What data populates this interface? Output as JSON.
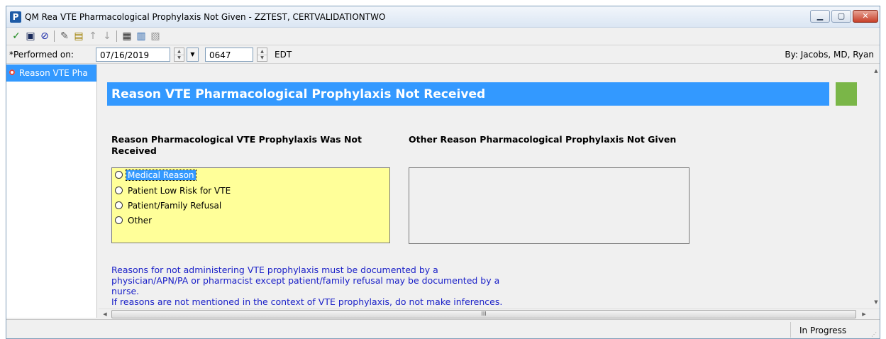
{
  "window": {
    "app_icon_letter": "P",
    "title": "QM Rea VTE Pharmacological Prophylaxis Not Given - ZZTEST, CERTVALIDATIONTWO",
    "min_glyph": "▁",
    "max_glyph": "▢",
    "close_glyph": "✕"
  },
  "toolbar": {
    "buttons": [
      {
        "icon": "checkmark-icon",
        "glyph": "✓",
        "color": "#1f8a1f"
      },
      {
        "icon": "save-icon",
        "glyph": "▣",
        "color": "#1a2a5a"
      },
      {
        "icon": "cancel-icon",
        "glyph": "⊘",
        "color": "#1a2aa8"
      },
      {
        "icon": "pen-icon",
        "glyph": "✎",
        "color": "#5a5a5a"
      },
      {
        "icon": "form-icon",
        "glyph": "▤",
        "color": "#a08000"
      },
      {
        "icon": "arrow-up-icon",
        "glyph": "↑",
        "color": "#a0a0a0"
      },
      {
        "icon": "arrow-down-icon",
        "glyph": "↓",
        "color": "#a0a0a0"
      },
      {
        "icon": "calculator-icon",
        "glyph": "▦",
        "color": "#2a2a2a"
      },
      {
        "icon": "calendar-icon",
        "glyph": "▥",
        "color": "#1a5aa8"
      },
      {
        "icon": "document-icon",
        "glyph": "▧",
        "color": "#909090"
      }
    ]
  },
  "performed": {
    "label": "*Performed on:",
    "date": "07/16/2019",
    "time": "0647",
    "timezone": "EDT",
    "by": "By:  Jacobs, MD, Ryan"
  },
  "nav": {
    "items": [
      {
        "label": "Reason VTE Pha",
        "selected": true
      }
    ]
  },
  "form": {
    "header_title": "Reason VTE Pharmacological Prophylaxis Not Received",
    "header_color": "#3399ff",
    "status_box_color": "#7ab648",
    "question1": "Reason Pharmacological VTE Prophylaxis Was Not Received",
    "options": [
      "Medical Reason",
      "Patient Low Risk for VTE",
      "Patient/Family Refusal",
      "Other"
    ],
    "question2": "Other Reason Pharmacological Prophylaxis Not Given",
    "other_value": "",
    "note_lines": [
      "Reasons for not administering VTE prophylaxis must be documented by a",
      "physician/APN/PA or pharmacist except patient/family refusal may be documented by a",
      "nurse.",
      "If reasons are not mentioned in the context of VTE prophylaxis, do not make inferences."
    ]
  },
  "scroll": {
    "up": "▲",
    "down": "▼",
    "left": "◀",
    "right": "▶",
    "thumb_grip": "III"
  },
  "status": {
    "text": "In Progress"
  }
}
